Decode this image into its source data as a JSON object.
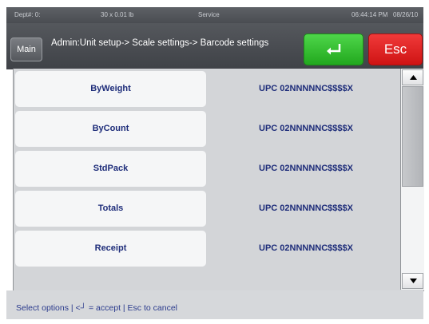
{
  "status_bar": {
    "dept": "Dept#: 0:",
    "weight": "30 x 0.01 lb",
    "mode": "Service",
    "time": "06:44:14 PM",
    "date": "08/26/10"
  },
  "header": {
    "main_label": "Main",
    "breadcrumb": "Admin:Unit setup-> Scale settings-> Barcode settings",
    "enter_icon": "enter-arrow-icon",
    "esc_label": "Esc"
  },
  "settings": [
    {
      "label": "ByWeight",
      "value": "UPC 02NNNNNC$$$$X"
    },
    {
      "label": "ByCount",
      "value": "UPC 02NNNNNC$$$$X"
    },
    {
      "label": "StdPack",
      "value": "UPC 02NNNNNC$$$$X"
    },
    {
      "label": "Totals",
      "value": "UPC 02NNNNNC$$$$X"
    },
    {
      "label": "Receipt",
      "value": "UPC 02NNNNNC$$$$X"
    }
  ],
  "footer": {
    "hint": "Select options | <┘ = accept | Esc to cancel"
  },
  "colors": {
    "accept": "#2ebd2a",
    "cancel": "#e12525",
    "text_blue": "#1e2d7a"
  }
}
